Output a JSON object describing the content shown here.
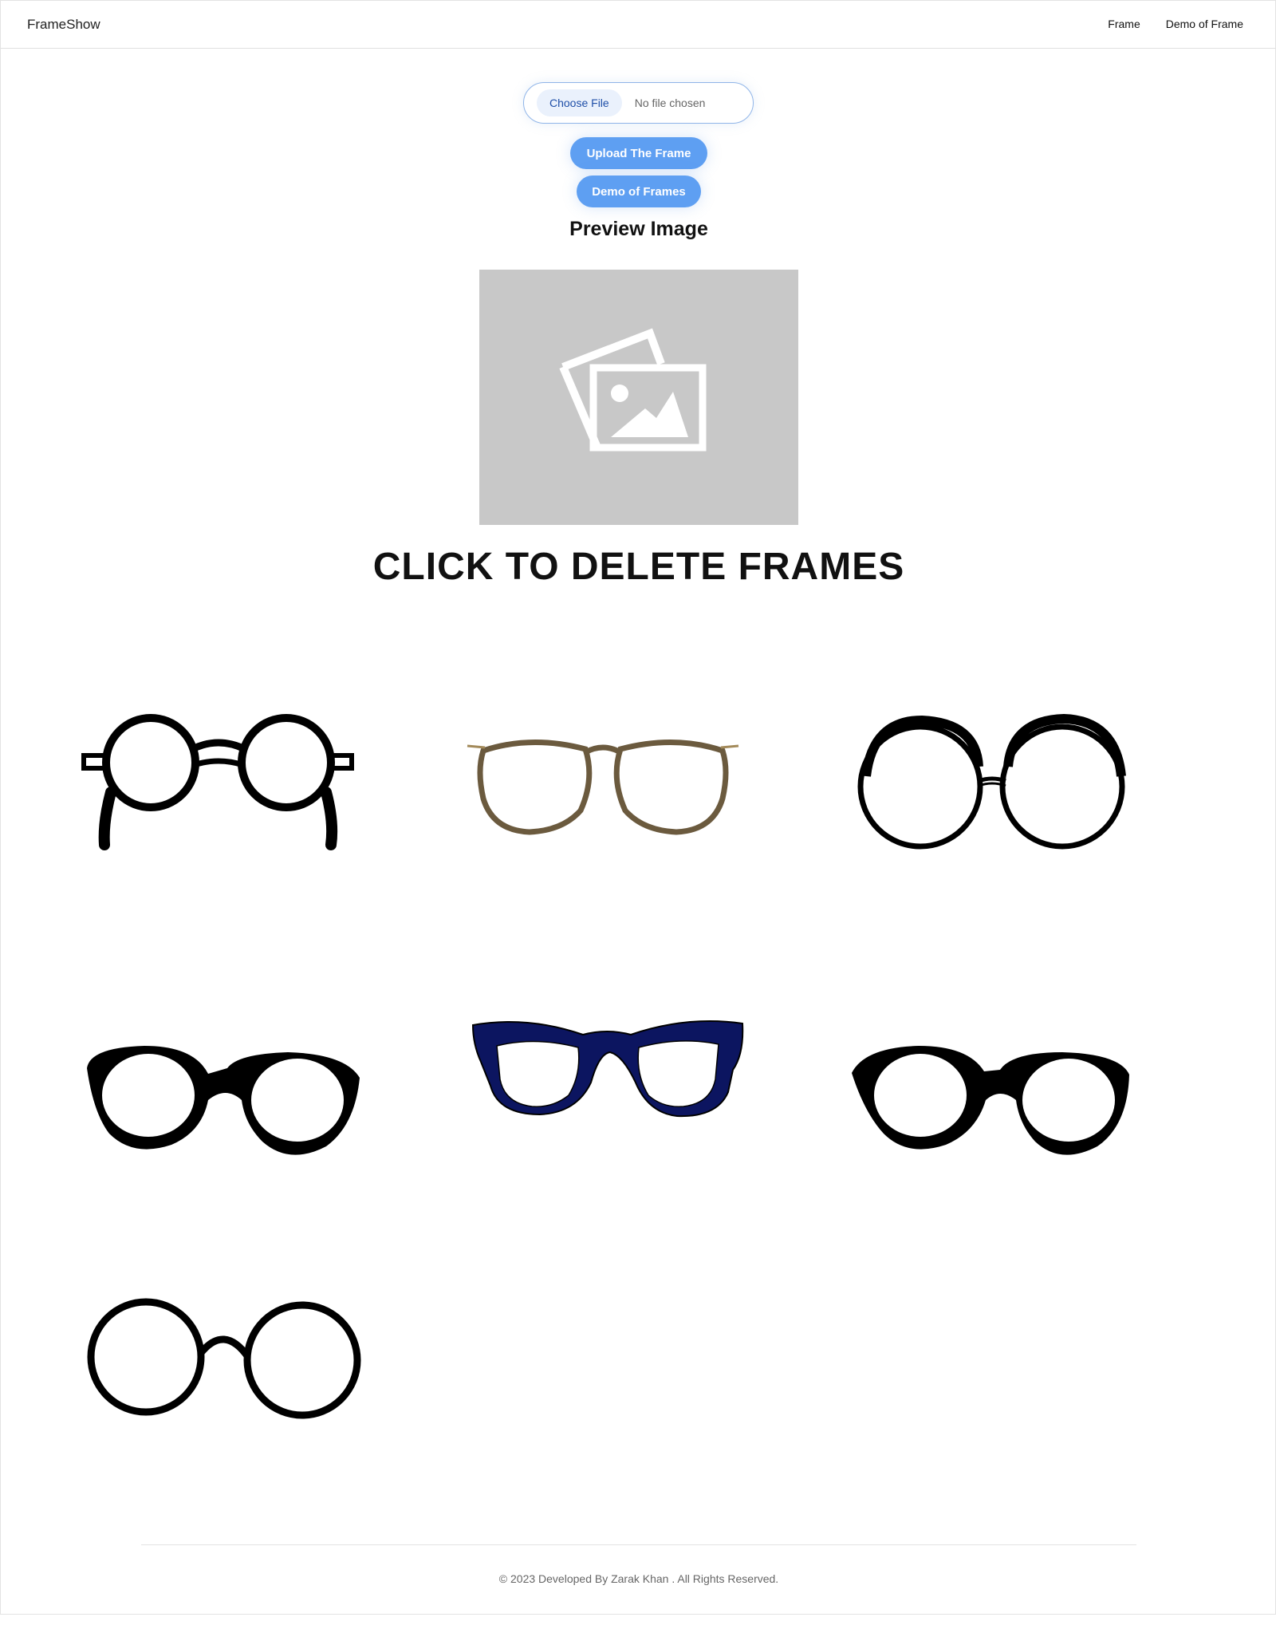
{
  "navbar": {
    "brand": "FrameShow",
    "links": [
      "Frame",
      "Demo of Frame"
    ]
  },
  "upload": {
    "choose_file_label": "Choose File",
    "file_status": "No file chosen",
    "upload_button": "Upload The Frame",
    "demo_button": "Demo of Frames"
  },
  "preview": {
    "title": "Preview Image",
    "icon": "image-placeholder-icon"
  },
  "frames_section": {
    "title": "CLICK TO DELETE FRAMES",
    "frames": [
      {
        "icon": "round-glasses-with-temples-icon",
        "color": "#000000"
      },
      {
        "icon": "tortoiseshell-glasses-icon",
        "color": "#6b5a3e"
      },
      {
        "icon": "sketch-round-glasses-icon",
        "color": "#000000"
      },
      {
        "icon": "thick-round-glasses-icon",
        "color": "#000000"
      },
      {
        "icon": "navy-wayfarer-glasses-icon",
        "color": "#0c1560"
      },
      {
        "icon": "thick-round-glasses-icon",
        "color": "#000000"
      },
      {
        "icon": "thin-round-glasses-icon",
        "color": "#000000"
      }
    ]
  },
  "footer": {
    "text": "© 2023 Developed By Zarak Khan . All Rights Reserved."
  },
  "colors": {
    "accent": "#5e9ff2",
    "file_border": "#8fb4e8",
    "preview_bg": "#c8c8c8"
  }
}
